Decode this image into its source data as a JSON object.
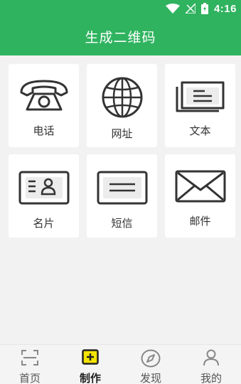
{
  "status_bar": {
    "time": "4:16"
  },
  "header": {
    "title": "生成二维码"
  },
  "grid": {
    "items": [
      {
        "label": "电话",
        "icon": "telephone-icon"
      },
      {
        "label": "网址",
        "icon": "globe-icon"
      },
      {
        "label": "文本",
        "icon": "document-icon"
      },
      {
        "label": "名片",
        "icon": "business-card-icon"
      },
      {
        "label": "短信",
        "icon": "sms-icon"
      },
      {
        "label": "邮件",
        "icon": "envelope-icon"
      }
    ]
  },
  "bottom_nav": {
    "items": [
      {
        "label": "首页",
        "icon": "scan-icon",
        "active": false
      },
      {
        "label": "制作",
        "icon": "add-icon",
        "active": true
      },
      {
        "label": "发现",
        "icon": "compass-icon",
        "active": false
      },
      {
        "label": "我的",
        "icon": "user-icon",
        "active": false
      }
    ]
  },
  "colors": {
    "primary": "#2fb35f",
    "active_icon": "#f5e400",
    "icon_stroke": "#333333"
  }
}
